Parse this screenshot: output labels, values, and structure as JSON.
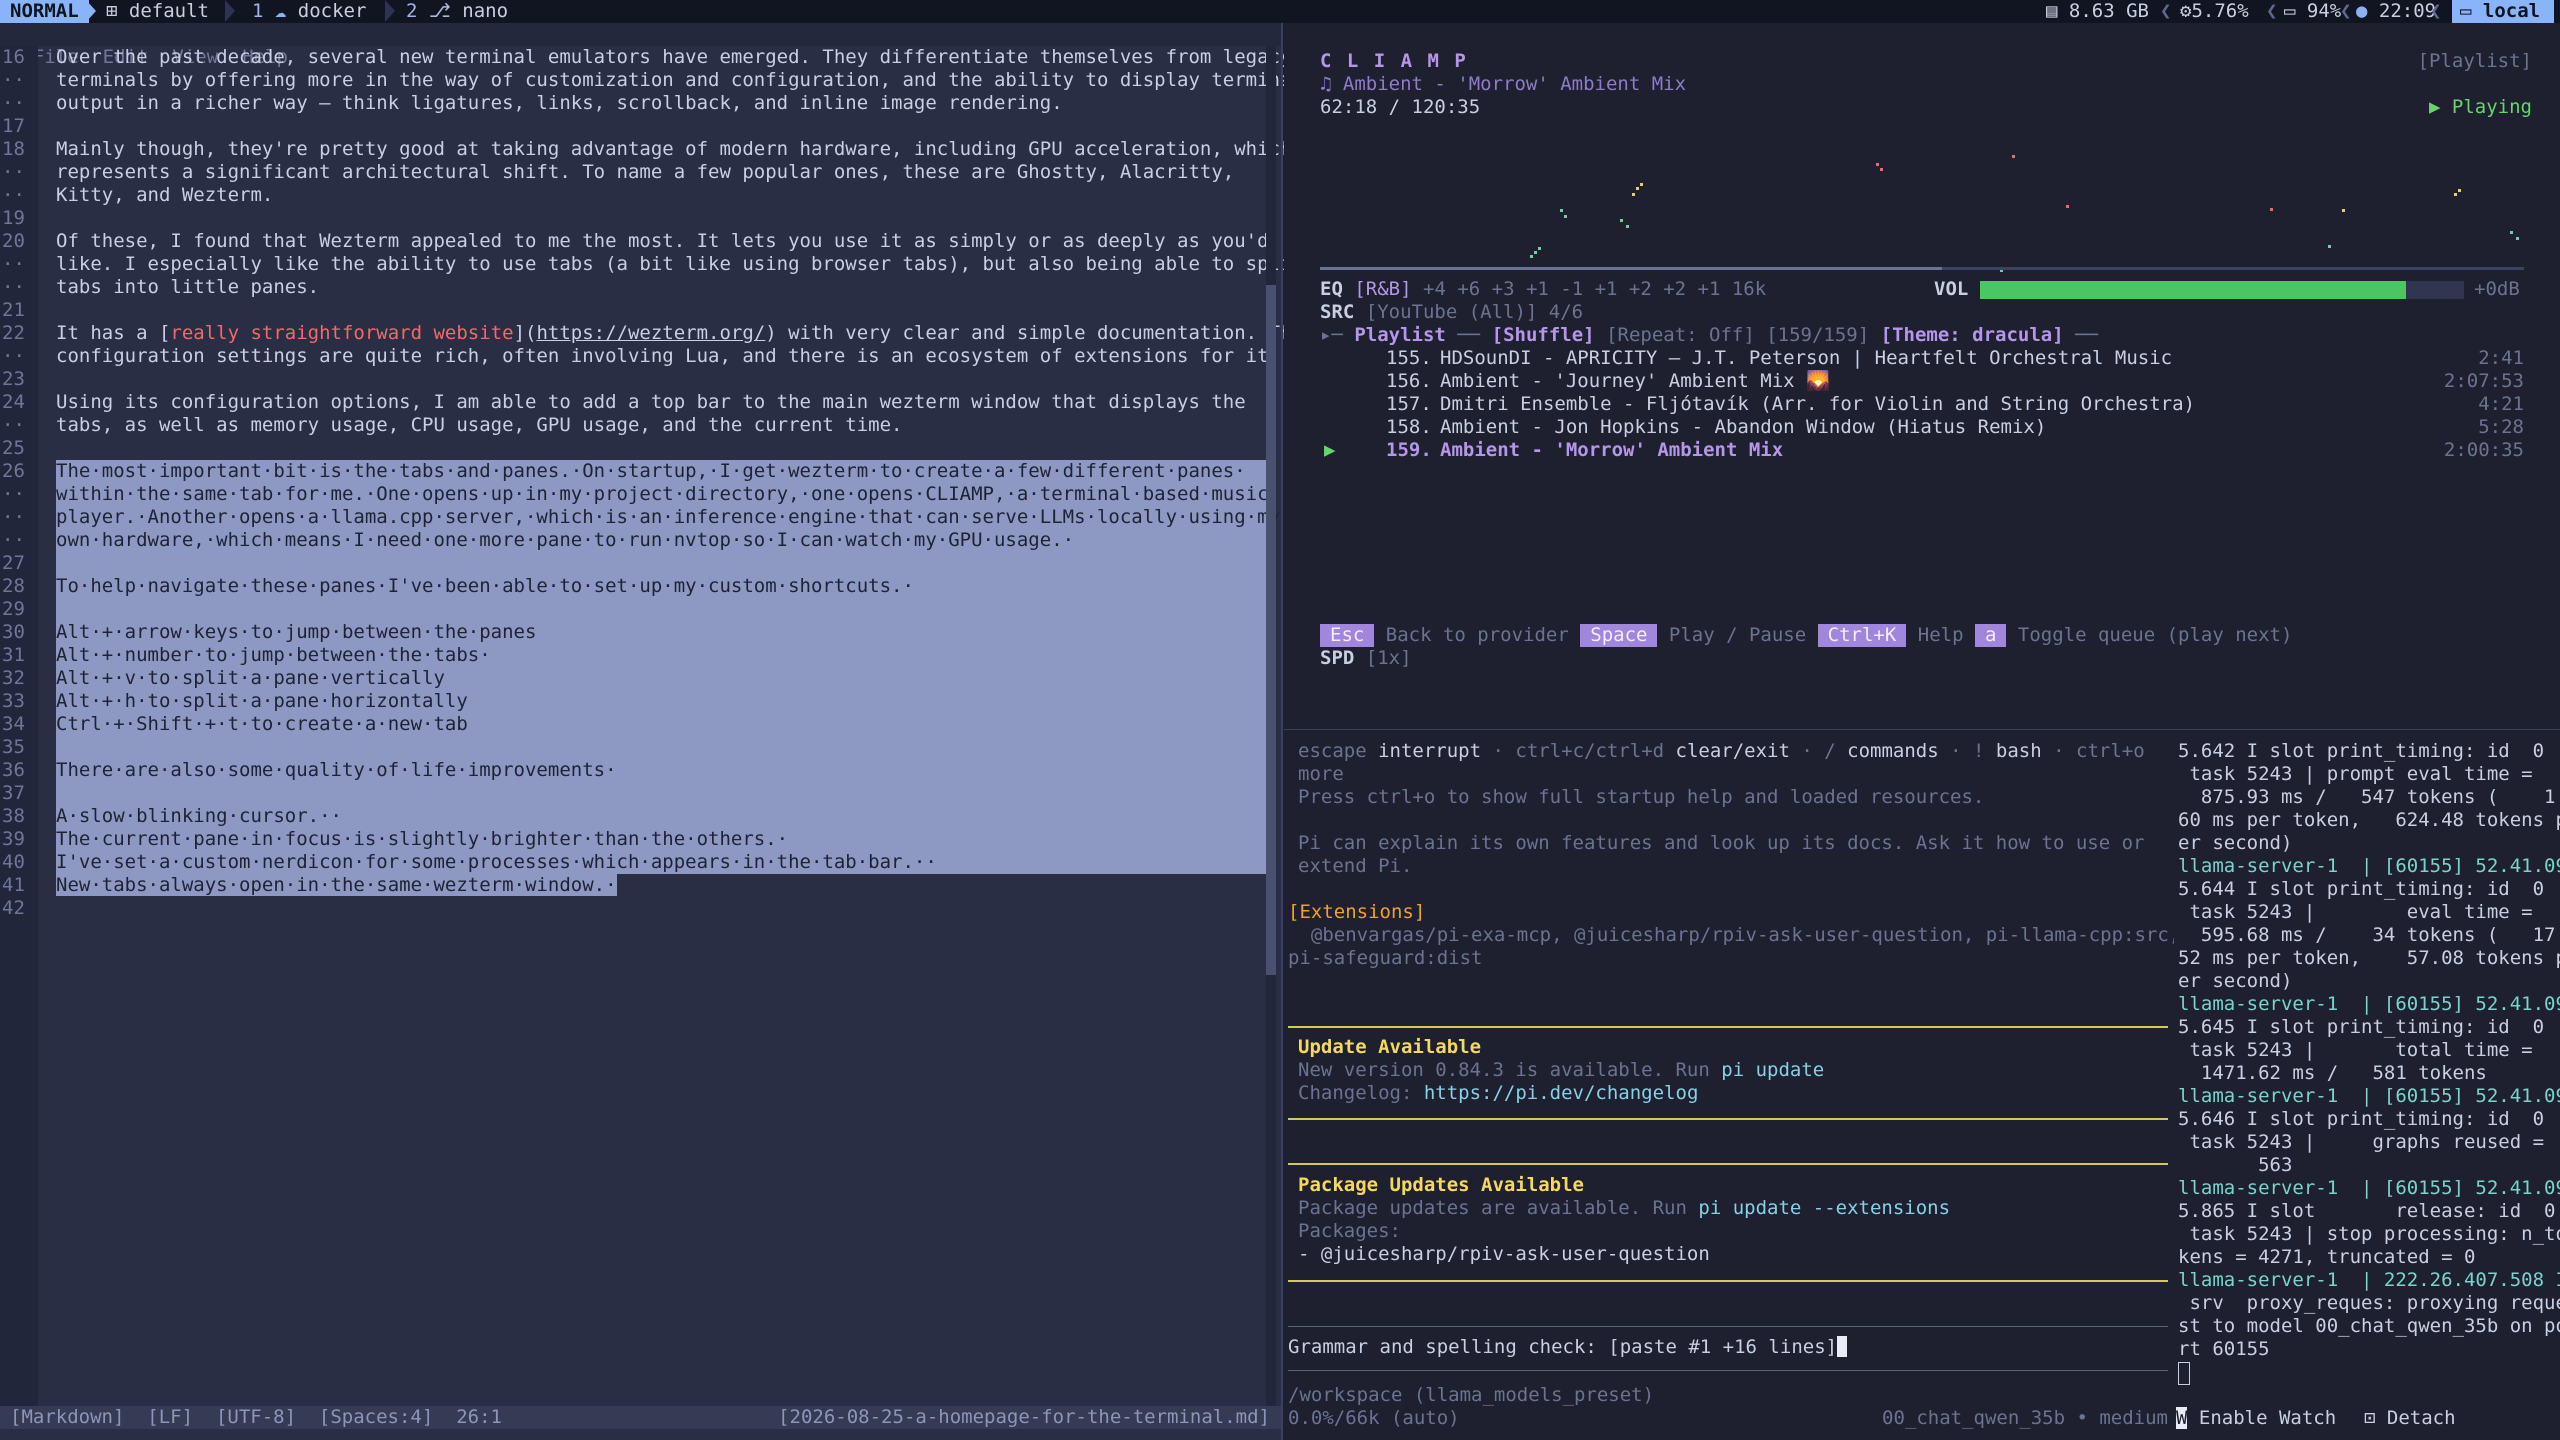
{
  "topbar": {
    "mode": "NORMAL",
    "workspace": "default",
    "tabs": [
      {
        "num": "1",
        "label": "docker"
      },
      {
        "num": "2",
        "label": "nano"
      }
    ],
    "memory": "8.63 GB",
    "cpu": "5.76%",
    "battery": "94%",
    "time": "22:09",
    "host": "local"
  },
  "editor": {
    "menu": [
      "File",
      "Edit",
      "View",
      "Help"
    ],
    "lines": [
      {
        "n": "16",
        "t": "Over the past decade, several new terminal emulators have emerged. They differentiate themselves from legacy"
      },
      {
        "n": "··",
        "t": "terminals by offering more in the way of customization and configuration, and the ability to display terminal"
      },
      {
        "n": "··",
        "t": "output in a richer way – think ligatures, links, scrollback, and inline image rendering."
      },
      {
        "n": "17",
        "t": ""
      },
      {
        "n": "18",
        "t": "Mainly though, they're pretty good at taking advantage of modern hardware, including GPU acceleration, which"
      },
      {
        "n": "··",
        "t": "represents a significant architectural shift. To name a few popular ones, these are Ghostty, Alacritty,"
      },
      {
        "n": "··",
        "t": "Kitty, and Wezterm."
      },
      {
        "n": "19",
        "t": ""
      },
      {
        "n": "20",
        "t": "Of these, I found that Wezterm appealed to me the most. It lets you use it as simply or as deeply as you'd"
      },
      {
        "n": "··",
        "t": "like. I especially like the ability to use tabs (a bit like using browser tabs), but also being able to split"
      },
      {
        "n": "··",
        "t": "tabs into little panes."
      },
      {
        "n": "21",
        "t": ""
      },
      {
        "n": "22",
        "pre": "It has a [",
        "link_text": "really straightforward website",
        "mid": "](",
        "url": "https://wezterm.org/",
        "post": ") with very clear and simple documentation. The"
      },
      {
        "n": "··",
        "t": "configuration settings are quite rich, often involving Lua, and there is an ecosystem of extensions for it."
      },
      {
        "n": "23",
        "t": ""
      },
      {
        "n": "24",
        "t": "Using its configuration options, I am able to add a top bar to the main wezterm window that displays the"
      },
      {
        "n": "··",
        "t": "tabs, as well as memory usage, CPU usage, GPU usage, and the current time."
      },
      {
        "n": "25",
        "t": ""
      },
      {
        "n": "26",
        "t": "The·most·important·bit·is·the·tabs·and·panes.·On·startup,·I·get·wezterm·to·create·a·few·different·panes·",
        "sel": true
      },
      {
        "n": "··",
        "t": "within·the·same·tab·for·me.·One·opens·up·in·my·project·directory,·one·opens·CLIAMP,·a·terminal·based·music·",
        "sel": true
      },
      {
        "n": "··",
        "t": "player.·Another·opens·a·llama.cpp·server,·which·is·an·inference·engine·that·can·serve·LLMs·locally·using·my·",
        "sel": true
      },
      {
        "n": "··",
        "t": "own·hardware,·which·means·I·need·one·more·pane·to·run·nvtop·so·I·can·watch·my·GPU·usage.·",
        "sel": true
      },
      {
        "n": "27",
        "t": "",
        "sel": true
      },
      {
        "n": "28",
        "t": "To·help·navigate·these·panes·I've·been·able·to·set·up·my·custom·shortcuts.·",
        "sel": true
      },
      {
        "n": "29",
        "t": "",
        "sel": true
      },
      {
        "n": "30",
        "t": "Alt·+·arrow·keys·to·jump·between·the·panes",
        "sel": true
      },
      {
        "n": "31",
        "t": "Alt·+·number·to·jump·between·the·tabs·",
        "sel": true
      },
      {
        "n": "32",
        "t": "Alt·+·v·to·split·a·pane·vertically",
        "sel": true
      },
      {
        "n": "33",
        "t": "Alt·+·h·to·split·a·pane·horizontally",
        "sel": true
      },
      {
        "n": "34",
        "t": "Ctrl·+·Shift·+·t·to·create·a·new·tab",
        "sel": true
      },
      {
        "n": "35",
        "t": "",
        "sel": true
      },
      {
        "n": "36",
        "t": "There·are·also·some·quality·of·life·improvements·",
        "sel": true
      },
      {
        "n": "37",
        "t": "",
        "sel": true
      },
      {
        "n": "38",
        "t": "A·slow·blinking·cursor.··",
        "sel": true
      },
      {
        "n": "39",
        "t": "The·current·pane·in·focus·is·slightly·brighter·than·the·others.·",
        "sel": true
      },
      {
        "n": "40",
        "t": "I've·set·a·custom·nerdicon·for·some·processes·which·appears·in·the·tab·bar.··",
        "sel": true
      },
      {
        "n": "41",
        "t": "New·tabs·always·open·in·the·same·wezterm·window.·",
        "sel": "partial"
      },
      {
        "n": "42",
        "t": ""
      }
    ],
    "status": {
      "syntax": "[Markdown]",
      "eol": "[LF]",
      "encoding": "[UTF-8]",
      "indent": "[Spaces:4]",
      "position": "26:1",
      "filename": "[2026-08-25-a-homepage-for-the-terminal.md]"
    }
  },
  "player": {
    "title": "C L I A M P",
    "view": "[Playlist]",
    "now_track": "♫ Ambient - 'Morrow' Ambient Mix",
    "elapsed": "62:18 / 120:35",
    "state": "▶ Playing",
    "eq_label": "EQ",
    "eq_preset": "[R&B]",
    "eq_bands": "+4 +6 +3 +1 -1 +1 +2 +2 +1 16k",
    "vol_label": "VOL",
    "volume_fraction": 0.88,
    "vol_db": "+0dB",
    "src_label": "SRC",
    "src_value": "[YouTube (All)] 4/6",
    "playlist_prefix": "▸─",
    "playlist_label": "Playlist",
    "playlist_sep": "──",
    "shuffle": "[Shuffle]",
    "repeat": "[Repeat: Off]",
    "count": "[159/159]",
    "theme": "[Theme: dracula]",
    "playlist_tail": "──",
    "tracks": [
      {
        "marker": "",
        "num": "155.",
        "title": "HDSounDI - APRICITY – J.T. Peterson | Heartfelt Orchestral Music",
        "dur": "2:41"
      },
      {
        "marker": "",
        "num": "156.",
        "title": "Ambient - 'Journey' Ambient Mix 🌄",
        "dur": "2:07:53"
      },
      {
        "marker": "",
        "num": "157.",
        "title": "Dmitri Ensemble - Fljótavík (Arr. for Violin and String Orchestra)",
        "dur": "4:21"
      },
      {
        "marker": "",
        "num": "158.",
        "title": "Ambient - Jon Hopkins - Abandon Window (Hiatus Remix)",
        "dur": "5:28"
      },
      {
        "marker": "▶",
        "num": "159.",
        "title": "Ambient - 'Morrow' Ambient Mix",
        "dur": "2:00:35",
        "current": true
      }
    ],
    "keys": [
      {
        "key": "Esc",
        "desc": "Back to provider"
      },
      {
        "key": "Space",
        "desc": "Play / Pause"
      },
      {
        "key": "Ctrl+K",
        "desc": "Help"
      },
      {
        "key": "a",
        "desc": "Toggle queue (play next)"
      }
    ],
    "spd_label": "SPD",
    "spd_value": "[1x]"
  },
  "pi": {
    "hint1_a": "escape",
    "hint1_b": "interrupt",
    "hint1_c": "· ctrl+c/ctrl+d",
    "hint1_d": "clear/exit",
    "hint1_e": "· /",
    "hint1_f": "commands",
    "hint1_g": "· !",
    "hint1_h": "bash",
    "hint1_i": "· ctrl+o",
    "hint2": "more",
    "hint3": "Press ctrl+o to show full startup help and loaded resources.",
    "hint4": "Pi can explain its own features and look up its docs. Ask it how to use or",
    "hint5": "extend Pi.",
    "extensions_head": "[Extensions]",
    "extensions_line1": "  @benvargas/pi-exa-mcp, @juicesharp/rpiv-ask-user-question, pi-llama-cpp:src,",
    "extensions_line2": "pi-safeguard:dist",
    "update_title": "Update Available",
    "update_text_a": "New version 0.84.3 is available. Run ",
    "update_cmd": "pi update",
    "changelog_label": "Changelog: ",
    "changelog_url": "https://pi.dev/changelog",
    "pkg_title": "Package Updates Available",
    "pkg_text_a": "Package updates are available. Run ",
    "pkg_cmd": "pi update --extensions",
    "pkg_label": "Packages:",
    "pkg_item": "- @juicesharp/rpiv-ask-user-question",
    "input_value": "Grammar and spelling check: [paste #1 +16 lines]",
    "cwd": "/workspace (llama_models_preset)",
    "context": "0.0%/66k (auto)",
    "model": "00_chat_qwen_35b • medium"
  },
  "log": {
    "lines": [
      {
        "t": "5.642 I slot print_timing: id  0 |"
      },
      {
        "t": " task 5243 | prompt eval time ="
      },
      {
        "t": "  875.93 ms /   547 tokens (    1."
      },
      {
        "t": "60 ms per token,   624.48 tokens p"
      },
      {
        "t": "er second)"
      },
      {
        "t": "llama-server-1  | [60155] 52.41.09",
        "name": true
      },
      {
        "t": "5.644 I slot print_timing: id  0 |"
      },
      {
        "t": " task 5243 |        eval time ="
      },
      {
        "t": "  595.68 ms /    34 tokens (   17."
      },
      {
        "t": "52 ms per token,    57.08 tokens p"
      },
      {
        "t": "er second)"
      },
      {
        "t": "llama-server-1  | [60155] 52.41.09",
        "name": true
      },
      {
        "t": "5.645 I slot print_timing: id  0 |"
      },
      {
        "t": " task 5243 |       total time ="
      },
      {
        "t": "  1471.62 ms /   581 tokens"
      },
      {
        "t": "llama-server-1  | [60155] 52.41.09",
        "name": true
      },
      {
        "t": "5.646 I slot print_timing: id  0 |"
      },
      {
        "t": " task 5243 |     graphs reused ="
      },
      {
        "t": "       563"
      },
      {
        "t": "llama-server-1  | [60155] 52.41.09",
        "name": true
      },
      {
        "t": "5.865 I slot       release: id  0 |"
      },
      {
        "t": " task 5243 | stop processing: n_to"
      },
      {
        "t": "kens = 4271, truncated = 0"
      },
      {
        "t": "llama-server-1  | 222.26.407.508 I",
        "name": true
      },
      {
        "t": " srv  proxy_reques: proxying reque"
      },
      {
        "t": "st to model 00_chat_qwen_35b on po"
      },
      {
        "t": "rt 60155"
      }
    ],
    "watch_label": "Enable Watch",
    "detach_label": "Detach"
  },
  "colors": {
    "accent": "#89b4fa",
    "selection": "#8d99c3",
    "playing": "#68d46e",
    "volume_bar": "#4cc563",
    "key_chip": "#a086dd",
    "update_heading": "#f5d95e"
  }
}
